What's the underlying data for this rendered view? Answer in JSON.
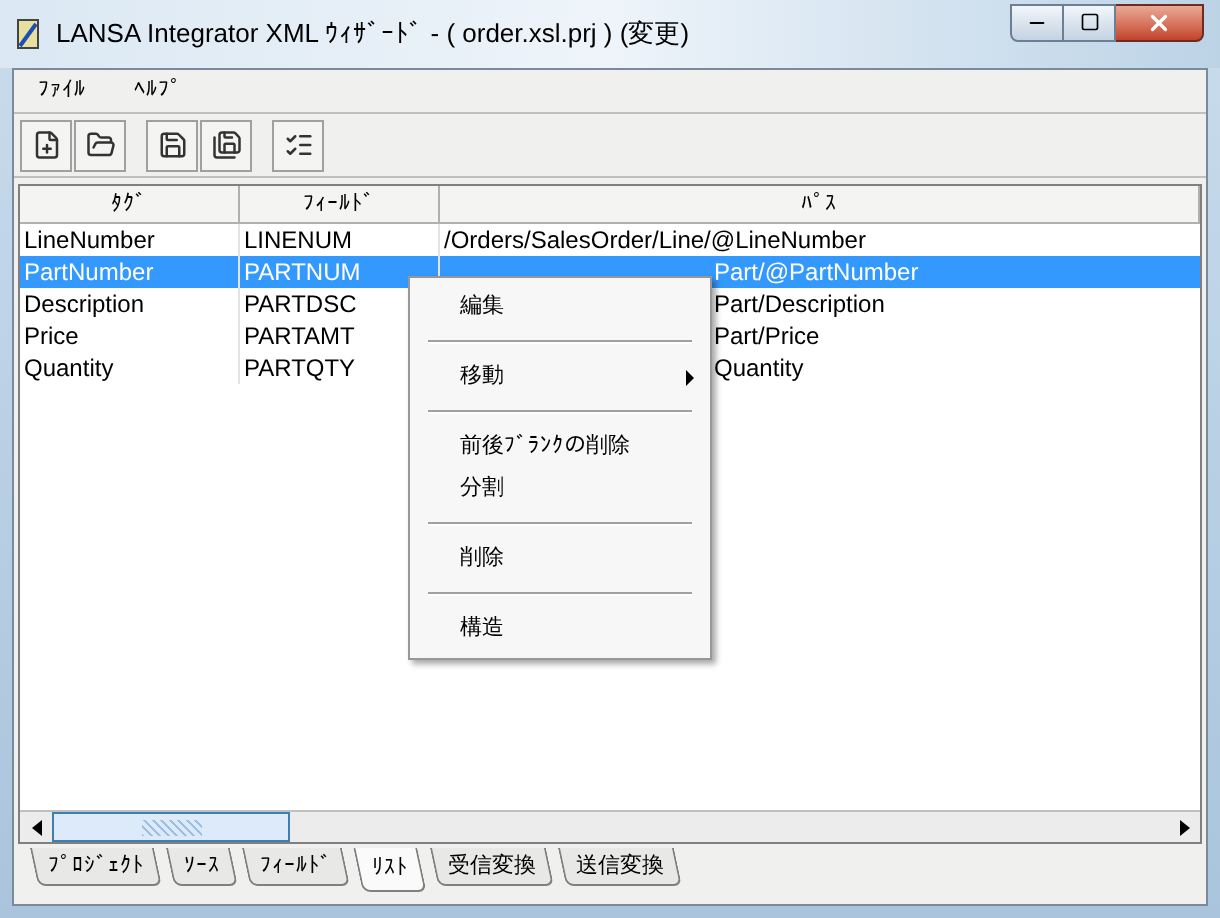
{
  "window": {
    "title": "LANSA Integrator XML ｳｨｻﾞｰﾄﾞ - ( order.xsl.prj ) (変更)"
  },
  "menu": [
    "ﾌｧｲﾙ",
    "ﾍﾙﾌﾟ"
  ],
  "table": {
    "columns": [
      "ﾀｸﾞ",
      "ﾌｨｰﾙﾄﾞ",
      "ﾊﾟｽ"
    ],
    "rows": [
      {
        "tag": "LineNumber",
        "field": "LINENUM",
        "path": "/Orders/SalesOrder/Line/@LineNumber",
        "selected": false
      },
      {
        "tag": "PartNumber",
        "field": "PARTNUM",
        "path": "Part/@PartNumber",
        "selected": true
      },
      {
        "tag": "Description",
        "field": "PARTDSC",
        "path": "Part/Description",
        "selected": false
      },
      {
        "tag": "Price",
        "field": "PARTAMT",
        "path": "Part/Price",
        "selected": false
      },
      {
        "tag": "Quantity",
        "field": "PARTQTY",
        "path": "Quantity",
        "selected": false
      }
    ]
  },
  "context_menu": [
    {
      "kind": "item",
      "label": "編集",
      "submenu": false
    },
    {
      "kind": "separator"
    },
    {
      "kind": "item",
      "label": "移動",
      "submenu": true
    },
    {
      "kind": "separator"
    },
    {
      "kind": "item",
      "label": "前後ﾌﾞﾗﾝｸの削除",
      "submenu": false
    },
    {
      "kind": "item",
      "label": "分割",
      "submenu": false
    },
    {
      "kind": "separator"
    },
    {
      "kind": "item",
      "label": "削除",
      "submenu": false
    },
    {
      "kind": "separator"
    },
    {
      "kind": "item",
      "label": "構造",
      "submenu": false
    }
  ],
  "tabs": [
    {
      "label": "ﾌﾟﾛｼﾞｪｸﾄ",
      "selected": false
    },
    {
      "label": "ｿｰｽ",
      "selected": false
    },
    {
      "label": "ﾌｨｰﾙﾄﾞ",
      "selected": false
    },
    {
      "label": "ﾘｽﾄ",
      "selected": true
    },
    {
      "label": "受信変換",
      "selected": false
    },
    {
      "label": "送信変換",
      "selected": false
    }
  ]
}
